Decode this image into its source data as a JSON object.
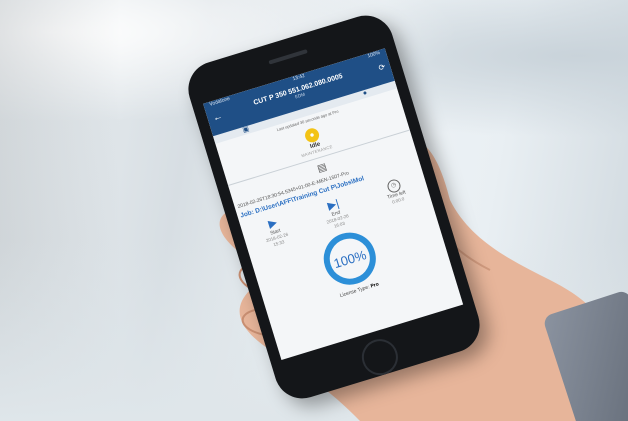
{
  "app": {
    "status_bar": {
      "left": "Vodafone",
      "center": "13:42",
      "right": "100%"
    },
    "title": "CUT P 350 551.062.080.0005",
    "subtitle": "EDM",
    "last_updated": "Last updated 30 seconds ago at Pro",
    "machine_status": {
      "label": "Idle",
      "sub": "MAINTENANCE"
    },
    "session_line": "2018-02-26T18:30:54.5345+01:00-E-MEN-1507-Pro",
    "job_path": "Job: D:\\User\\AFF\\Training Cut P\\Jobs\\Mol",
    "timing": {
      "start": {
        "label": "Start",
        "value1": "2018-02-26",
        "value2": "15:33"
      },
      "end": {
        "label": "End",
        "value1": "2018-02-26",
        "value2": "16:03"
      },
      "time_left": {
        "label": "Time left",
        "value": "0:00:0"
      }
    },
    "progress": {
      "value": 100,
      "text": "100%"
    },
    "license": {
      "label": "License Type:",
      "value": "Pro"
    }
  },
  "colors": {
    "app_bar": "#1f4f86",
    "accent": "#2a6fc2",
    "status_idle": "#f3c316"
  },
  "icons": [
    "back-arrow-icon",
    "refresh-icon",
    "machine-icon",
    "user-icon",
    "status-icon",
    "printer-icon",
    "play-icon",
    "skip-end-icon",
    "clock-icon"
  ]
}
